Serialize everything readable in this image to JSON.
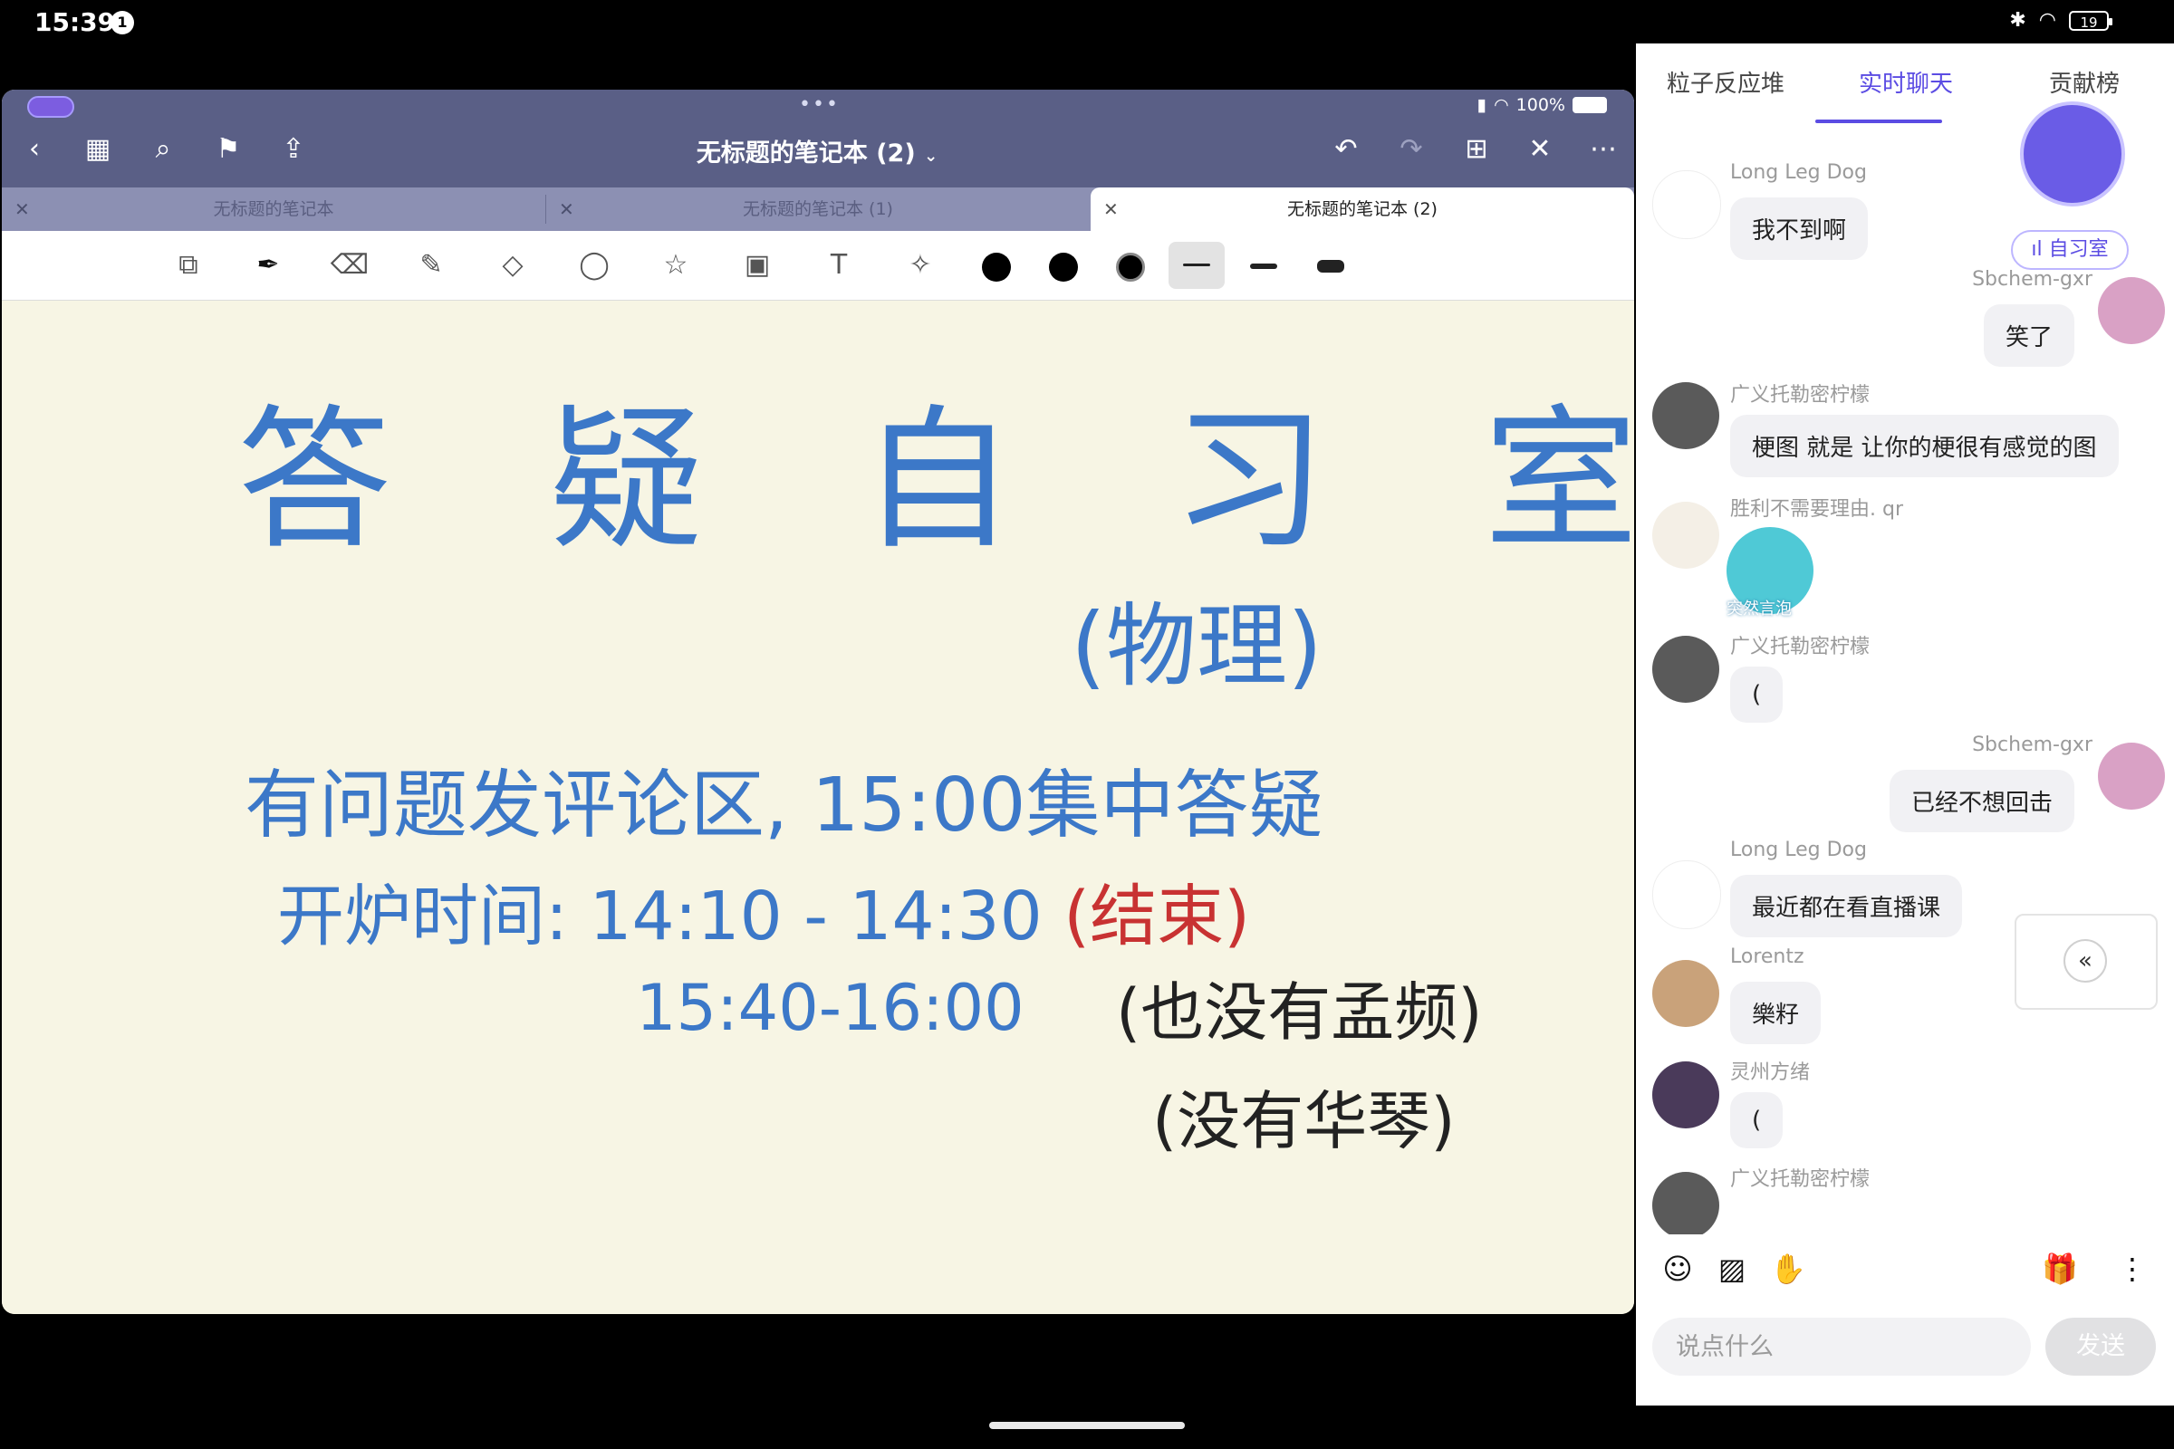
{
  "status_bar": {
    "time": "15:39",
    "notification_count": "1",
    "battery": "19"
  },
  "notes_app": {
    "ipad_battery": "100%",
    "title": "无标题的笔记本 (2)",
    "tabs": [
      {
        "label": "无标题的笔记本"
      },
      {
        "label": "无标题的笔记本 (1)"
      },
      {
        "label": "无标题的笔记本 (2)"
      }
    ],
    "handwriting": {
      "title": "答 疑 自 习 室",
      "subtitle": "(物理)",
      "line1": "有问题发评论区, 15:00集中答疑",
      "line2_label": "开炉时间: 14:10 - 14:30",
      "line2_red": "(结束)",
      "line3_time": "15:40-16:00",
      "line3_note": "(也没有孟频)",
      "line4": "(没有华琴)"
    }
  },
  "chat": {
    "tabs": [
      "粒子反应堆",
      "实时聊天",
      "贡献榜"
    ],
    "active_tab": "实时聊天",
    "study_room_label": "自习室",
    "messages": [
      {
        "name": "Long Leg Dog",
        "text": "我不到啊",
        "side": "left"
      },
      {
        "name": "Sbchem-gxr",
        "text": "笑了",
        "side": "right"
      },
      {
        "name": "广义托勒密柠檬",
        "text": "梗图 就是 让你的梗很有感觉的图",
        "side": "left"
      },
      {
        "name": "胜利不需要理由. qr",
        "text": "",
        "side": "left",
        "sticker_caption": "突然言泡"
      },
      {
        "name": "广义托勒密柠檬",
        "text": "(",
        "side": "left"
      },
      {
        "name": "Sbchem-gxr",
        "text": "已经不想回击",
        "side": "right"
      },
      {
        "name": "Long Leg Dog",
        "text": "最近都在看直播课",
        "side": "left"
      },
      {
        "name": "Lorentz",
        "text": "樂籽",
        "side": "left"
      },
      {
        "name": "灵州方绪",
        "text": "(",
        "side": "left"
      },
      {
        "name": "广义托勒密柠檬",
        "text": "",
        "side": "left"
      }
    ],
    "input_placeholder": "说点什么",
    "send_label": "发送"
  },
  "colors": {
    "accent": "#5b4ce3",
    "ink_blue": "#3c78c8",
    "ink_red": "#c83232",
    "notes_header": "#5a5f86",
    "paper": "#f7f5e4"
  }
}
